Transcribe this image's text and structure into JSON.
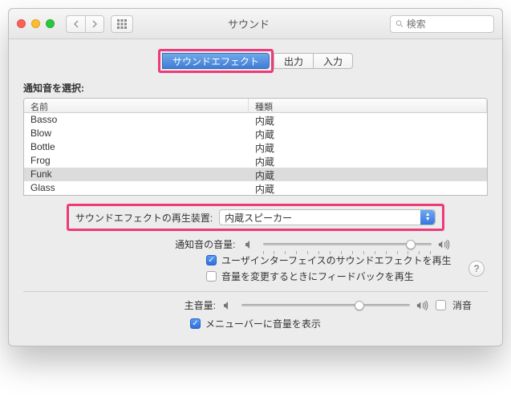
{
  "titlebar": {
    "title": "サウンド",
    "search_placeholder": "検索"
  },
  "tabs": [
    {
      "label": "サウンドエフェクト",
      "active": true
    },
    {
      "label": "出力",
      "active": false
    },
    {
      "label": "入力",
      "active": false
    }
  ],
  "alert_section_label": "通知音を選択:",
  "table": {
    "cols": {
      "name": "名前",
      "kind": "種類"
    },
    "rows": [
      {
        "name": "Basso",
        "kind": "内蔵",
        "selected": false
      },
      {
        "name": "Blow",
        "kind": "内蔵",
        "selected": false
      },
      {
        "name": "Bottle",
        "kind": "内蔵",
        "selected": false
      },
      {
        "name": "Frog",
        "kind": "内蔵",
        "selected": false
      },
      {
        "name": "Funk",
        "kind": "内蔵",
        "selected": true
      },
      {
        "name": "Glass",
        "kind": "内蔵",
        "selected": false
      }
    ]
  },
  "device": {
    "label": "サウンドエフェクトの再生装置:",
    "value": "内蔵スピーカー"
  },
  "alert_volume": {
    "label": "通知音の音量:",
    "pct": 88
  },
  "checks": {
    "ui_sfx": {
      "label": "ユーザインターフェイスのサウンドエフェクトを再生",
      "checked": true
    },
    "feedback": {
      "label": "音量を変更するときにフィードバックを再生",
      "checked": false
    }
  },
  "main_volume": {
    "label": "主音量:",
    "pct": 70,
    "mute_label": "消音",
    "mute_checked": false
  },
  "menubar": {
    "label": "メニューバーに音量を表示",
    "checked": true
  },
  "help": "?"
}
